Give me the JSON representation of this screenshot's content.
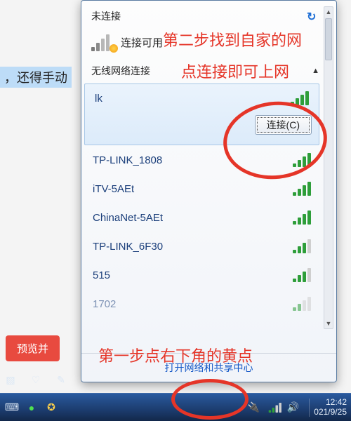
{
  "bg": {
    "partial_text": "，还得手动"
  },
  "panel": {
    "not_connected": "未连接",
    "available": "连接可用",
    "section_title": "无线网络连接",
    "connect_label": "连接(C)",
    "footer_link": "打开网络和共享中心"
  },
  "networks": [
    {
      "ssid": "lk",
      "strength": 4,
      "selected": true
    },
    {
      "ssid": "TP-LINK_1808",
      "strength": 4,
      "selected": false
    },
    {
      "ssid": "iTV-5AEt",
      "strength": 4,
      "selected": false
    },
    {
      "ssid": "ChinaNet-5AEt",
      "strength": 4,
      "selected": false
    },
    {
      "ssid": "TP-LINK_6F30",
      "strength": 3,
      "selected": false
    },
    {
      "ssid": "515",
      "strength": 3,
      "selected": false
    },
    {
      "ssid": "1702",
      "strength": 2,
      "selected": false
    }
  ],
  "taskbar": {
    "time": "12:42",
    "date": "021/9/25"
  },
  "annotations": {
    "step2_l1": "第二步找到自家的网",
    "step2_l2": "点连接即可上网",
    "step1": "第一步点右下角的黄点"
  },
  "preview_button": "预览并"
}
